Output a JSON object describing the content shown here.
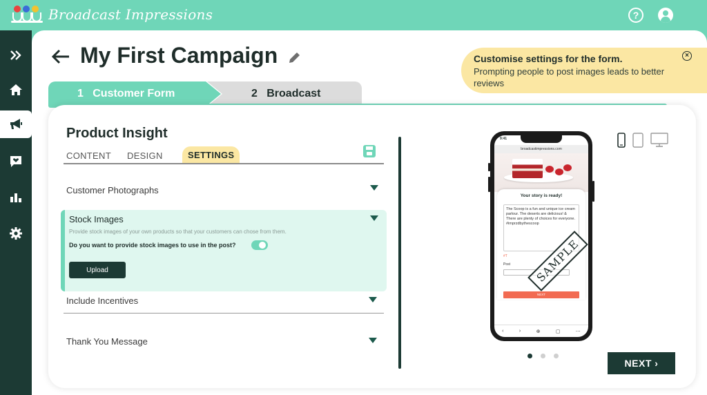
{
  "app": {
    "brand": "Broadcast Impressions"
  },
  "header": {
    "help_icon": "question-circle-icon",
    "user_icon": "user-circle-icon"
  },
  "sidebar": {
    "items": [
      {
        "icon": "chevrons-right-icon"
      },
      {
        "icon": "home-icon"
      },
      {
        "icon": "megaphone-icon",
        "active": true
      },
      {
        "icon": "chat-heart-icon"
      },
      {
        "icon": "bar-chart-icon"
      },
      {
        "icon": "gear-icon"
      }
    ]
  },
  "page": {
    "title": "My First Campaign"
  },
  "tip": {
    "title": "Customise settings for the form.",
    "body": "Prompting people to post images leads to better reviews"
  },
  "steps": [
    {
      "number": "1",
      "label": "Customer Form",
      "active": true
    },
    {
      "number": "2",
      "label": "Broadcast",
      "active": false
    }
  ],
  "form": {
    "title": "Product Insight",
    "tabs": [
      "CONTENT",
      "DESIGN",
      "SETTINGS"
    ],
    "active_tab": "SETTINGS",
    "sections": {
      "customer_photographs": "Customer Photographs",
      "stock_images": {
        "label": "Stock Images",
        "description": "Provide stock images of your own products so that your customers can chose from them.",
        "question": "Do you want to provide stock images to use in the post?",
        "toggle_on": true,
        "upload_label": "Upload"
      },
      "include_incentives": "Include Incentives",
      "thank_you": "Thank You Message"
    }
  },
  "preview": {
    "status_time": "9:41",
    "url": "broadcastimpressions.com",
    "story_title": "Your story is ready!",
    "story_text": "The Scoop is a fun and unique ice cream parlour. The deserts are delicious! & There are plenty of choices for everyone. #imprzdbythescoop",
    "tool_label": "#T",
    "post_label": "Post",
    "next_label": "NEXT",
    "stamp": "SAMPLE",
    "nav": [
      "‹",
      "›",
      "⊕",
      "▢",
      "⋯"
    ]
  },
  "pagination": {
    "count": 3,
    "active": 0
  },
  "footer": {
    "next_label": "NEXT"
  },
  "colors": {
    "accent": "#6fd6b8",
    "dark": "#1c3a34",
    "tip": "#fbe7a3",
    "cta": "#f26b52"
  }
}
